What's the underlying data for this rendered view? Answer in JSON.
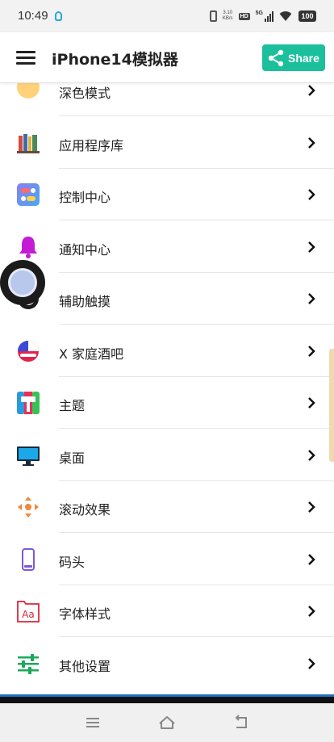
{
  "status_bar": {
    "time": "10:49",
    "net_speed_value": "3.10",
    "net_speed_unit": "KB/s",
    "hd_badge": "HD",
    "network": "5G",
    "battery": "100"
  },
  "app_bar": {
    "menu_icon": "hamburger-menu-icon",
    "title": "iPhone14模拟器",
    "share_label": "Share",
    "share_color": "#1cbf9b"
  },
  "list": {
    "items": [
      {
        "label": "深色模式",
        "icon": "dark-mode-icon"
      },
      {
        "label": "应用程序库",
        "icon": "app-library-icon"
      },
      {
        "label": "控制中心",
        "icon": "control-center-icon"
      },
      {
        "label": "通知中心",
        "icon": "bell-icon"
      },
      {
        "label": "辅助触摸",
        "icon": "assistive-touch-icon"
      },
      {
        "label": "X 家庭酒吧",
        "icon": "home-bar-icon"
      },
      {
        "label": "主题",
        "icon": "theme-paint-roller-icon"
      },
      {
        "label": "桌面",
        "icon": "desktop-monitor-icon"
      },
      {
        "label": "滚动效果",
        "icon": "scroll-effect-icon"
      },
      {
        "label": "码头",
        "icon": "dock-phone-icon"
      },
      {
        "label": "字体样式",
        "icon": "font-style-icon"
      },
      {
        "label": "其他设置",
        "icon": "sliders-settings-icon"
      }
    ]
  },
  "nav_bar": {
    "menu_icon": "nav-menu-icon",
    "home_icon": "nav-home-icon",
    "back_icon": "nav-back-icon"
  }
}
